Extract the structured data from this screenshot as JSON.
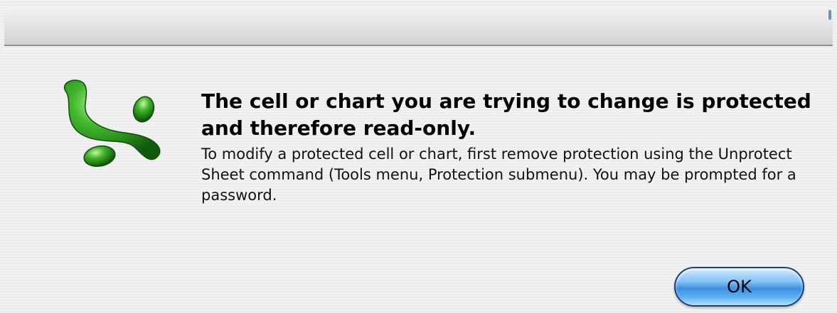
{
  "dialog": {
    "headline": "The cell or chart you are trying to change is protected and therefore read-only.",
    "message": "To modify a protected cell or chart, first remove protection using the Unprotect Sheet command (Tools menu, Protection submenu). You may be prompted for a password.",
    "ok_label": "OK",
    "app_icon": "excel-icon"
  },
  "colors": {
    "icon_green": "#2a9a1e",
    "button_blue": "#3e90e0"
  }
}
